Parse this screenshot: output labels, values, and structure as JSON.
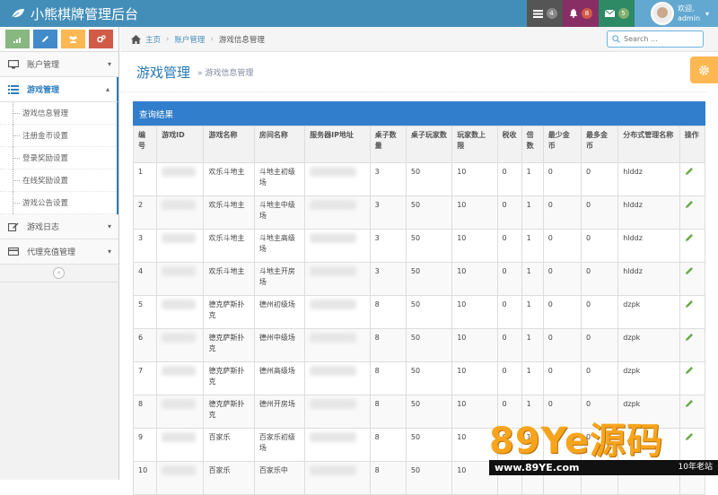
{
  "app": {
    "title": "小熊棋牌管理后台"
  },
  "topnav": {
    "tasks_count": "4",
    "notifications_count": "8",
    "messages_count": "5",
    "user_greeting": "欢迎,",
    "user_name": "admin"
  },
  "sidebar": {
    "shortcuts": [
      {
        "icon": "signal-icon",
        "color": "#87b87f"
      },
      {
        "icon": "pencil-icon",
        "color": "#428bca"
      },
      {
        "icon": "users-icon",
        "color": "#ffb752"
      },
      {
        "icon": "cogs-icon",
        "color": "#d15b47"
      }
    ],
    "items": [
      {
        "label": "账户管理",
        "icon": "desktop-icon"
      },
      {
        "label": "游戏管理",
        "icon": "list-icon"
      },
      {
        "label": "游戏日志",
        "icon": "edit-icon"
      },
      {
        "label": "代理充值管理",
        "icon": "card-icon"
      }
    ],
    "subitems": [
      "游戏信息管理",
      "注册金币设置",
      "登录奖励设置",
      "在线奖励设置",
      "游戏公告设置"
    ]
  },
  "breadcrumb": {
    "home": "主页",
    "account": "账户管理",
    "current": "游戏信息管理"
  },
  "search": {
    "placeholder": "Search ..."
  },
  "page": {
    "title": "游戏管理",
    "subtitle": "» 游戏信息管理"
  },
  "panel": {
    "title": "查询结果"
  },
  "table": {
    "headers": [
      "编号",
      "游戏ID",
      "游戏名称",
      "房间名称",
      "服务器IP地址",
      "桌子数量",
      "桌子玩家数",
      "玩家数上限",
      "税收",
      "倍数",
      "最少金币",
      "最多金币",
      "分布式管理名称",
      "操作"
    ],
    "rows": [
      {
        "no": "1",
        "game": "欢乐斗地主",
        "room": "斗地主初级场",
        "tables": "3",
        "players": "50",
        "max": "10",
        "tax": "0",
        "mult": "1",
        "min": "0",
        "most": "0",
        "dist": "hlddz"
      },
      {
        "no": "2",
        "game": "欢乐斗地主",
        "room": "斗地主中级场",
        "tables": "3",
        "players": "50",
        "max": "10",
        "tax": "0",
        "mult": "1",
        "min": "0",
        "most": "0",
        "dist": "hlddz"
      },
      {
        "no": "3",
        "game": "欢乐斗地主",
        "room": "斗地主高级场",
        "tables": "3",
        "players": "50",
        "max": "10",
        "tax": "0",
        "mult": "1",
        "min": "0",
        "most": "0",
        "dist": "hlddz"
      },
      {
        "no": "4",
        "game": "欢乐斗地主",
        "room": "斗地主开房场",
        "tables": "3",
        "players": "50",
        "max": "10",
        "tax": "0",
        "mult": "1",
        "min": "0",
        "most": "0",
        "dist": "hlddz"
      },
      {
        "no": "5",
        "game": "德克萨斯扑克",
        "room": "德州初级场",
        "tables": "8",
        "players": "50",
        "max": "10",
        "tax": "0",
        "mult": "1",
        "min": "0",
        "most": "0",
        "dist": "dzpk"
      },
      {
        "no": "6",
        "game": "德克萨斯扑克",
        "room": "德州中级场",
        "tables": "8",
        "players": "50",
        "max": "10",
        "tax": "0",
        "mult": "1",
        "min": "0",
        "most": "0",
        "dist": "dzpk"
      },
      {
        "no": "7",
        "game": "德克萨斯扑克",
        "room": "德州高级场",
        "tables": "8",
        "players": "50",
        "max": "10",
        "tax": "0",
        "mult": "1",
        "min": "0",
        "most": "0",
        "dist": "dzpk"
      },
      {
        "no": "8",
        "game": "德克萨斯扑克",
        "room": "德州开房场",
        "tables": "8",
        "players": "50",
        "max": "10",
        "tax": "0",
        "mult": "1",
        "min": "0",
        "most": "0",
        "dist": "dzpk"
      },
      {
        "no": "9",
        "game": "百家乐",
        "room": "百家乐初级场",
        "tables": "8",
        "players": "50",
        "max": "10",
        "tax": "0",
        "mult": "1",
        "min": "0",
        "most": "0",
        "dist": ""
      },
      {
        "no": "10",
        "game": "百家乐",
        "room": "百家乐中",
        "tables": "8",
        "players": "50",
        "max": "10",
        "tax": "0",
        "mult": "1",
        "min": "0",
        "most": "0",
        "dist": ""
      }
    ]
  },
  "watermark": {
    "logo": "89Ye源码",
    "url": "www.89YE.com",
    "tag": "10年老站"
  },
  "colors": {
    "header": "#438eb9",
    "panel": "#307ecc",
    "tasks": "#555555",
    "notifications": "#a0a0a0",
    "messages": "#2e8965",
    "settings": "#ffb752"
  }
}
